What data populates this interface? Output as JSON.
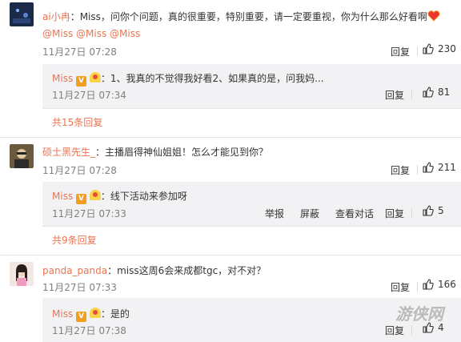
{
  "comments": [
    {
      "user": "ai小冉",
      "text": "：Miss，问你个问题，真的很重要，特别重要，请一定要重视，你为什么那么好看啊",
      "mentions": "@Miss @Miss @Miss",
      "time": "11月27日 07:28",
      "reply_label": "回复",
      "likes": "230",
      "reply": {
        "user": "Miss",
        "text": "：1、我真的不觉得我好看2、如果真的是，问我妈...",
        "time": "11月27日 07:34",
        "reply_label": "回复",
        "likes": "81"
      },
      "more": "共15条回复"
    },
    {
      "user": "硕士黑先生_",
      "text": "：主播眉得神仙姐姐！怎么才能见到你？",
      "time": "11月27日 07:28",
      "reply_label": "回复",
      "likes": "211",
      "reply": {
        "user": "Miss",
        "text": "：线下活动来参加呀",
        "time": "11月27日 07:33",
        "report_label": "举报",
        "block_label": "屏蔽",
        "view_dialog_label": "查看对话",
        "reply_label": "回复",
        "likes": "5"
      },
      "more": "共9条回复"
    },
    {
      "user": "panda_panda",
      "text": "：miss这周6会来成都tgc，对不对？",
      "time": "11月27日 07:33",
      "reply_label": "回复",
      "likes": "166",
      "reply": {
        "user": "Miss",
        "text": "：是的",
        "time": "11月27日 07:38",
        "reply_label": "回复",
        "likes": "4"
      }
    }
  ],
  "watermark": "游侠网",
  "colors": {
    "username": "#eb7350",
    "reply_bg": "#f2f2f5",
    "time": "#808080"
  }
}
